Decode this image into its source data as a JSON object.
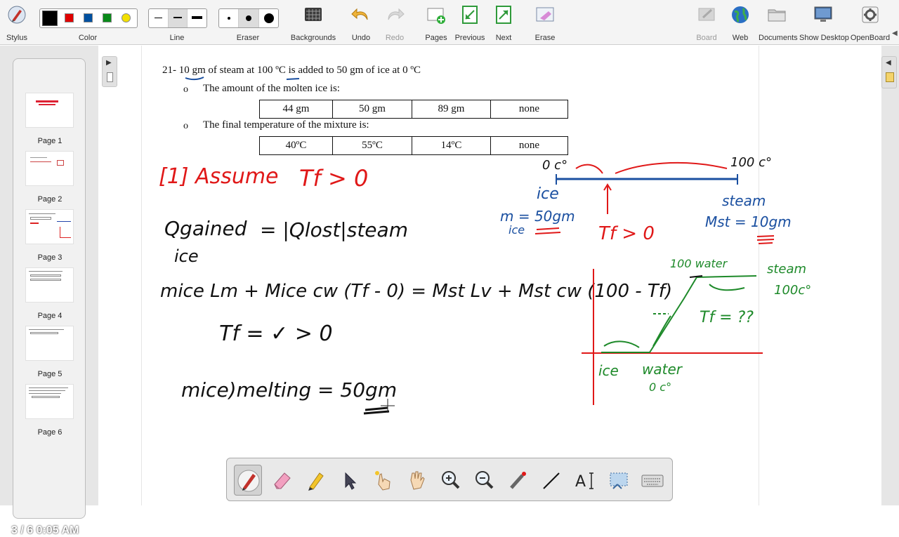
{
  "toolbar": {
    "stylus": "Stylus",
    "color": "Color",
    "line": "Line",
    "eraser": "Eraser",
    "backgrounds": "Backgrounds",
    "undo": "Undo",
    "redo": "Redo",
    "pages": "Pages",
    "previous": "Previous",
    "next": "Next",
    "erase": "Erase",
    "board": "Board",
    "web": "Web",
    "documents": "Documents",
    "show_desktop": "Show Desktop",
    "openboard": "OpenBoard",
    "colors": [
      "#000000",
      "#e00000",
      "#0050a0",
      "#0a8a1a",
      "#f2e000"
    ]
  },
  "pages": {
    "items": [
      {
        "label": "Page 1"
      },
      {
        "label": "Page 2"
      },
      {
        "label": "Page 3"
      },
      {
        "label": "Page 4"
      },
      {
        "label": "Page 5"
      },
      {
        "label": "Page 6"
      }
    ],
    "status": "3 / 6 0:05 AM"
  },
  "document": {
    "question": "21- 10 gm of steam at 100 ºC is added to 50 gm of ice at 0 ºC",
    "bullet_symbol": "o",
    "q1": "The amount of the molten ice is:",
    "q1_options": [
      "44 gm",
      "50 gm",
      "89 gm",
      "none"
    ],
    "q2": "The final temperature of the mixture is:",
    "q2_options": [
      "40ºC",
      "55ºC",
      "14ºC",
      "none"
    ]
  },
  "handwriting": {
    "assume": "[1] Assume",
    "tf_gt_0": "Tf > 0",
    "eq1_left": "Qgained",
    "eq1_right": "= |Qlost|steam",
    "eq1_sub": "ice",
    "eq2": "mice Lm + Mice cw (Tf - 0) = Mst Lv + Mst cw (100 - Tf)",
    "tf_result": "Tf = ✓  > 0",
    "melting": "mice)melting = 50gm",
    "line_left": "0 c°",
    "line_right": "100 c°",
    "ice_label": "ice",
    "steam_label": "steam",
    "m_ice": "m = 50gm",
    "m_ice_sub": "ice",
    "m_st": "Mst = 10gm",
    "tf_arrow": "Tf > 0",
    "graph_100water": "100 water",
    "graph_steam": "steam",
    "graph_100c": "100c°",
    "graph_tf": "Tf = ??",
    "graph_ice": "ice",
    "graph_water": "water",
    "graph_0c": "0 c°"
  },
  "palette": {
    "tools": [
      "pen-tool",
      "eraser-tool",
      "marker-tool",
      "selector-tool",
      "interact-tool",
      "hand-tool",
      "zoom-in-tool",
      "zoom-out-tool",
      "laser-pointer-tool",
      "line-tool",
      "text-tool",
      "capture-tool",
      "keyboard-tool"
    ]
  }
}
